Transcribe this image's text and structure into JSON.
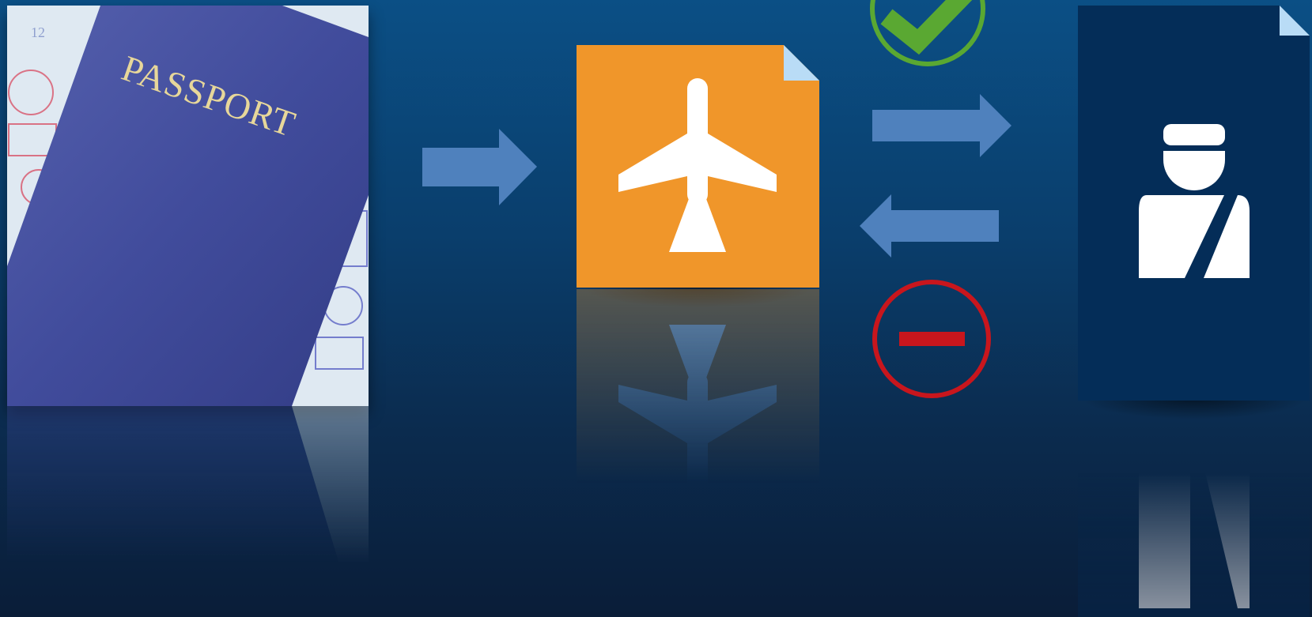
{
  "passport": {
    "cover_text": "PASSPORT",
    "cover_color": "#3f4a9a",
    "text_color": "#e7d79a"
  },
  "flight_document": {
    "color": "#f0962a",
    "fold_color": "#b9dcf6",
    "icon": "airplane-icon"
  },
  "officer_document": {
    "color": "#042d58",
    "fold_color": "#b9dcf6",
    "icon": "officer-icon"
  },
  "arrows": {
    "color": "#4f81bd"
  },
  "status": {
    "approved": {
      "icon": "check-circle-icon",
      "color": "#5aa832"
    },
    "rejected": {
      "icon": "minus-circle-icon",
      "color": "#c8161d"
    }
  }
}
